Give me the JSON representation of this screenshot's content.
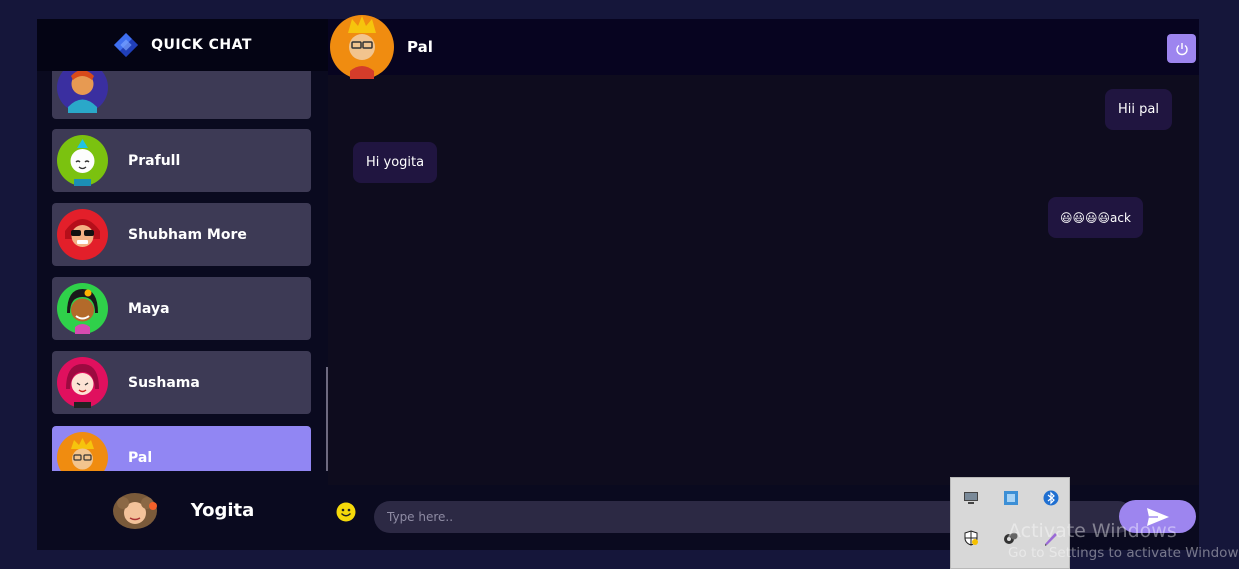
{
  "app": {
    "brand": "QUICK CHAT",
    "colors": {
      "accent": "#9186f3",
      "background": "#0e0c1e",
      "sidebar_card": "#3d3a55",
      "bubble": "#201540"
    }
  },
  "sidebar": {
    "contacts": [
      {
        "name": "",
        "avatar": "avatar-orange-hair",
        "active": false
      },
      {
        "name": "Prafull",
        "avatar": "avatar-white-mohawk",
        "active": false
      },
      {
        "name": "Shubham More",
        "avatar": "avatar-red-sunglasses",
        "active": false
      },
      {
        "name": "Maya",
        "avatar": "avatar-green-flower",
        "active": false
      },
      {
        "name": "Sushama",
        "avatar": "avatar-pink-hair",
        "active": false
      },
      {
        "name": "Pal",
        "avatar": "avatar-crown-glasses",
        "active": true
      }
    ],
    "current_user": {
      "name": "Yogita",
      "avatar": "avatar-curly-hair"
    }
  },
  "chat": {
    "contact_name": "Pal",
    "contact_avatar": "avatar-crown-glasses",
    "power_icon": "power-icon",
    "messages": [
      {
        "text": "Hii pal",
        "direction": "outgoing"
      },
      {
        "text": "Hi yogita",
        "direction": "incoming"
      },
      {
        "text": "😃😃😃😃ack",
        "direction": "outgoing"
      }
    ],
    "composer": {
      "placeholder": "Type here..",
      "emoji_icon": "emoji-icon",
      "send_icon": "send-icon"
    }
  },
  "os": {
    "watermark_title": "Activate Windows",
    "watermark_subtitle": "Go to Settings to activate Windows.",
    "tray_icons": [
      "monitor-icon",
      "network-icon",
      "bluetooth-icon",
      "security-shield-icon",
      "speaker-icon",
      "pen-icon"
    ]
  }
}
